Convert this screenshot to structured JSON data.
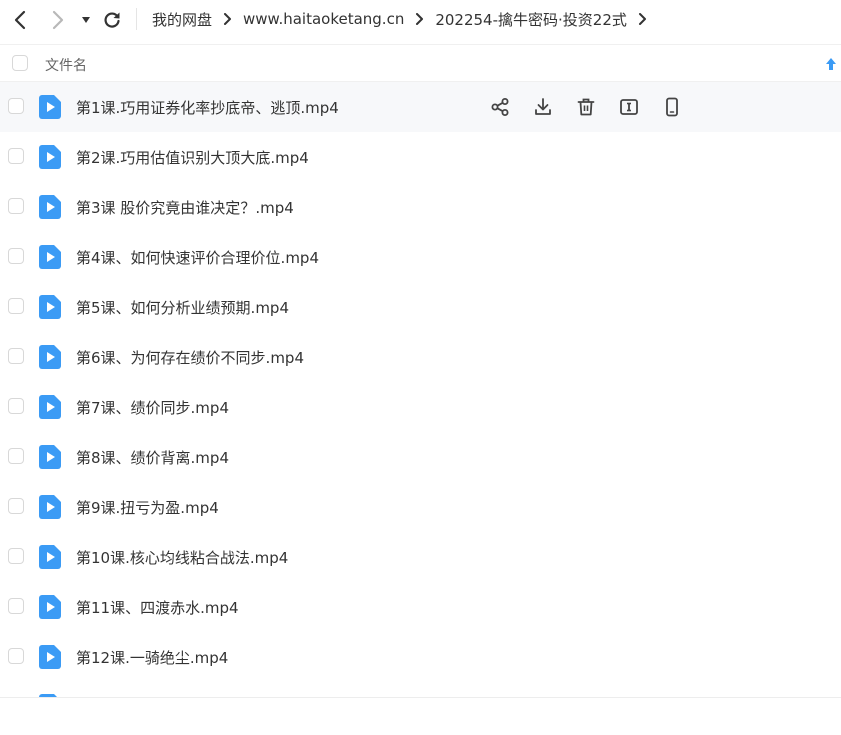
{
  "breadcrumb": [
    "我的网盘",
    "www.haitaoketang.cn",
    "202254-擒牛密码·投资22式"
  ],
  "header": {
    "column_name": "文件名"
  },
  "files": [
    {
      "name": "第1课.巧用证券化率抄底帝、逃顶.mp4"
    },
    {
      "name": "第2课.巧用估值识别大顶大底.mp4"
    },
    {
      "name": "第3课 股价究竟由谁决定？.mp4"
    },
    {
      "name": "第4课、如何快速评价合理价位.mp4"
    },
    {
      "name": "第5课、如何分析业绩预期.mp4"
    },
    {
      "name": "第6课、为何存在绩价不同步.mp4"
    },
    {
      "name": "第7课、绩价同步.mp4"
    },
    {
      "name": "第8课、绩价背离.mp4"
    },
    {
      "name": "第9课.扭亏为盈.mp4"
    },
    {
      "name": "第10课.核心均线粘合战法.mp4"
    },
    {
      "name": "第11课、四渡赤水.mp4"
    },
    {
      "name": "第12课.一骑绝尘.mp4"
    }
  ],
  "colors": {
    "accent": "#3b9bf5",
    "icon_gray": "#444444"
  }
}
